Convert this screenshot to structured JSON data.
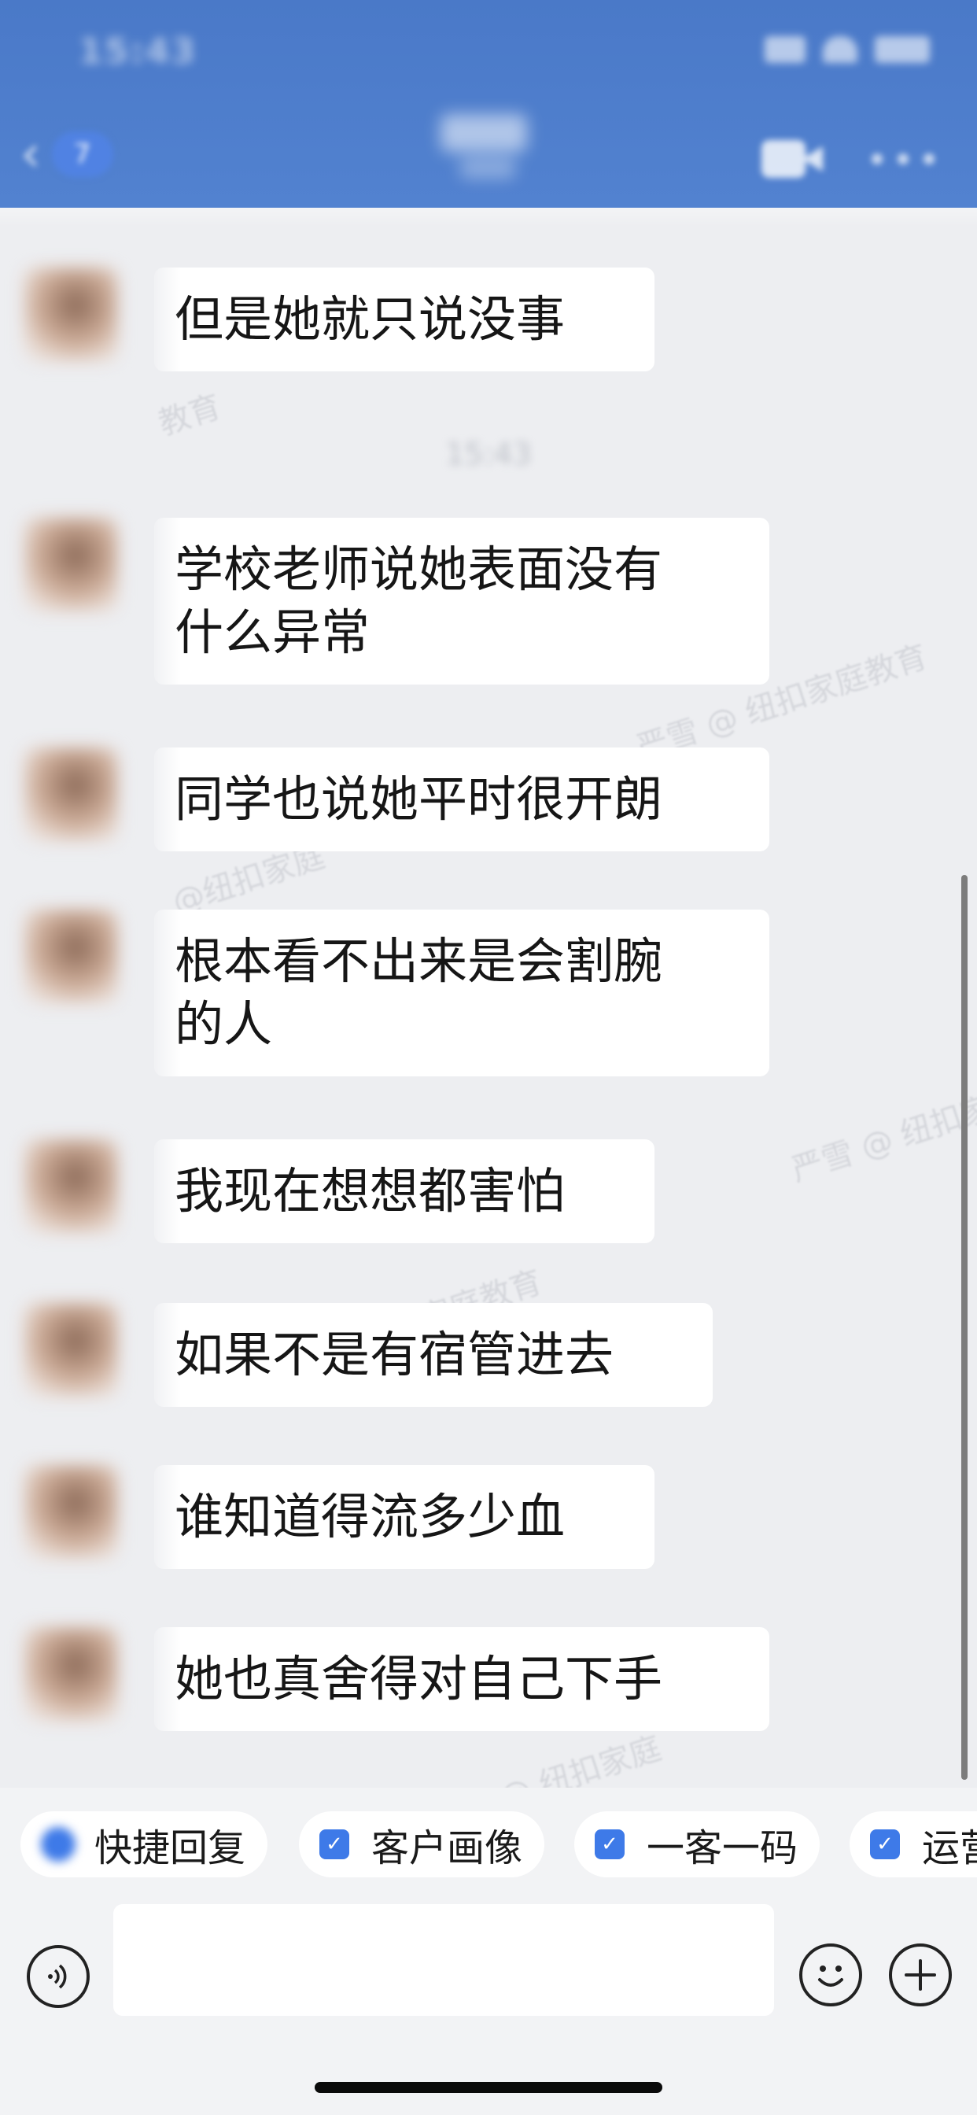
{
  "status_bar": {
    "time": "15:43"
  },
  "header": {
    "back_badge": "7"
  },
  "time_separator": "15:43",
  "messages": [
    {
      "text": "但是她就只说没事"
    },
    {
      "text": "学校老师说她表面没有\n什么异常"
    },
    {
      "text": "同学也说她平时很开朗"
    },
    {
      "text": "根本看不出来是会割腕\n的人"
    },
    {
      "text": "我现在想想都害怕"
    },
    {
      "text": "如果不是有宿管进去"
    },
    {
      "text": "谁知道得流多少血"
    },
    {
      "text": "她也真舍得对自己下手"
    }
  ],
  "watermarks": [
    "教育",
    "严雪 @ 纽扣家庭教育",
    "@纽扣家庭",
    "严雪 @ 纽扣家",
    "家庭教育",
    "严雪 @ 纽扣家庭"
  ],
  "quick_replies": [
    {
      "label": "快捷回复"
    },
    {
      "label": "客户画像"
    },
    {
      "label": "一客一码"
    },
    {
      "label": "运营"
    }
  ],
  "input": {
    "value": "",
    "placeholder": ""
  },
  "colors": {
    "header": "#4A79C8",
    "chat_bg": "#EDEEF1",
    "bubble": "#FFFFFF",
    "accent": "#3E7AE8"
  },
  "icons": [
    "back-chevron-icon",
    "video-call-icon",
    "more-icon",
    "voice-icon",
    "emoji-icon",
    "plus-icon",
    "checkbox-icon"
  ]
}
